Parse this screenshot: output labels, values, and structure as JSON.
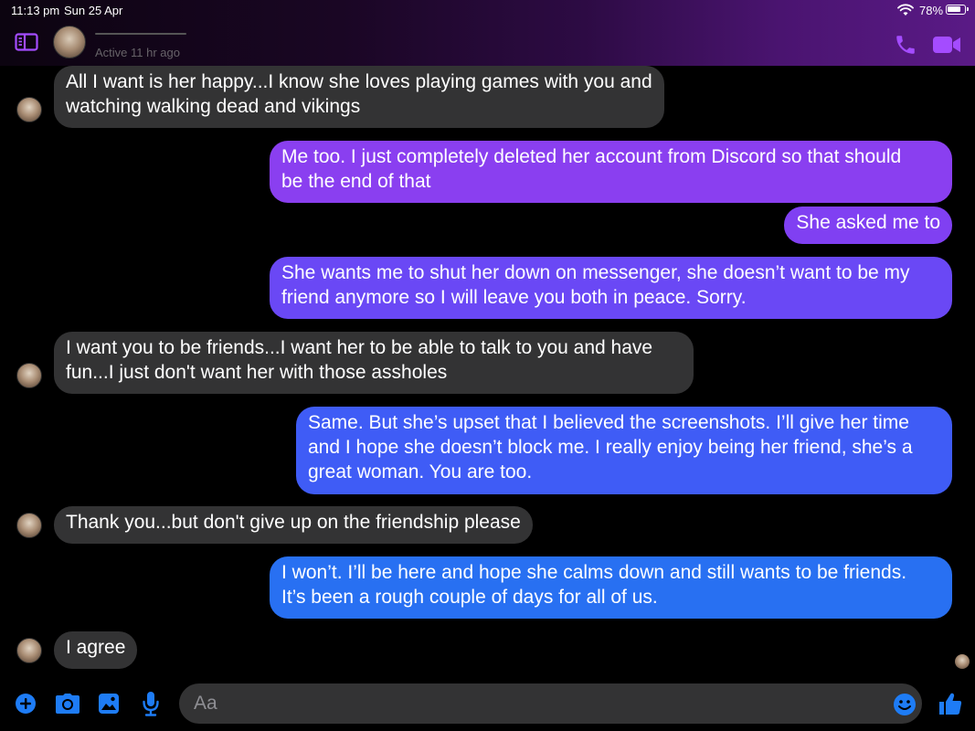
{
  "status_bar": {
    "time": "11:13 pm",
    "date": "Sun 25 Apr",
    "battery": "78%"
  },
  "header": {
    "active_status": "Active 11 hr ago",
    "accent_color": "#a44cff"
  },
  "messages": [
    {
      "direction": "in",
      "text": "All I want is her happy...I know she loves playing games with you and\nwatching walking dead and vikings",
      "show_avatar": true
    },
    {
      "direction": "out",
      "text": "Me too. I just completely deleted her account from Discord so that should\nbe the end of that",
      "color": "#8a3ff0"
    },
    {
      "direction": "out",
      "text": "She asked me to",
      "color": "#8040f2"
    },
    {
      "direction": "out",
      "text": "She wants me to shut her down on messenger, she doesn’t want to be my\nfriend anymore so I will leave you both in peace. Sorry.",
      "color": "#6a48f5"
    },
    {
      "direction": "in",
      "text": "I want you to be friends...I want her to be able to talk to you and have\nfun...I just don't want her with those assholes",
      "show_avatar": true
    },
    {
      "direction": "out",
      "text": "Same. But she’s upset that I believed the screenshots. I’ll give her time\nand I hope she doesn’t block me. I really enjoy being her friend, she’s a\ngreat woman. You are too.",
      "color": "#3f5cf6"
    },
    {
      "direction": "in",
      "text": "Thank you...but don't give up on the friendship please",
      "show_avatar": true
    },
    {
      "direction": "out",
      "text": "I won’t. I’ll be here and hope she calms down and still wants to be friends.\nIt’s been a rough couple of days for all of us.",
      "color": "#2870f2"
    },
    {
      "direction": "in",
      "text": "I agree",
      "show_avatar": true
    }
  ],
  "composer": {
    "placeholder": "Aa",
    "icon_color": "#1e7cf5"
  }
}
